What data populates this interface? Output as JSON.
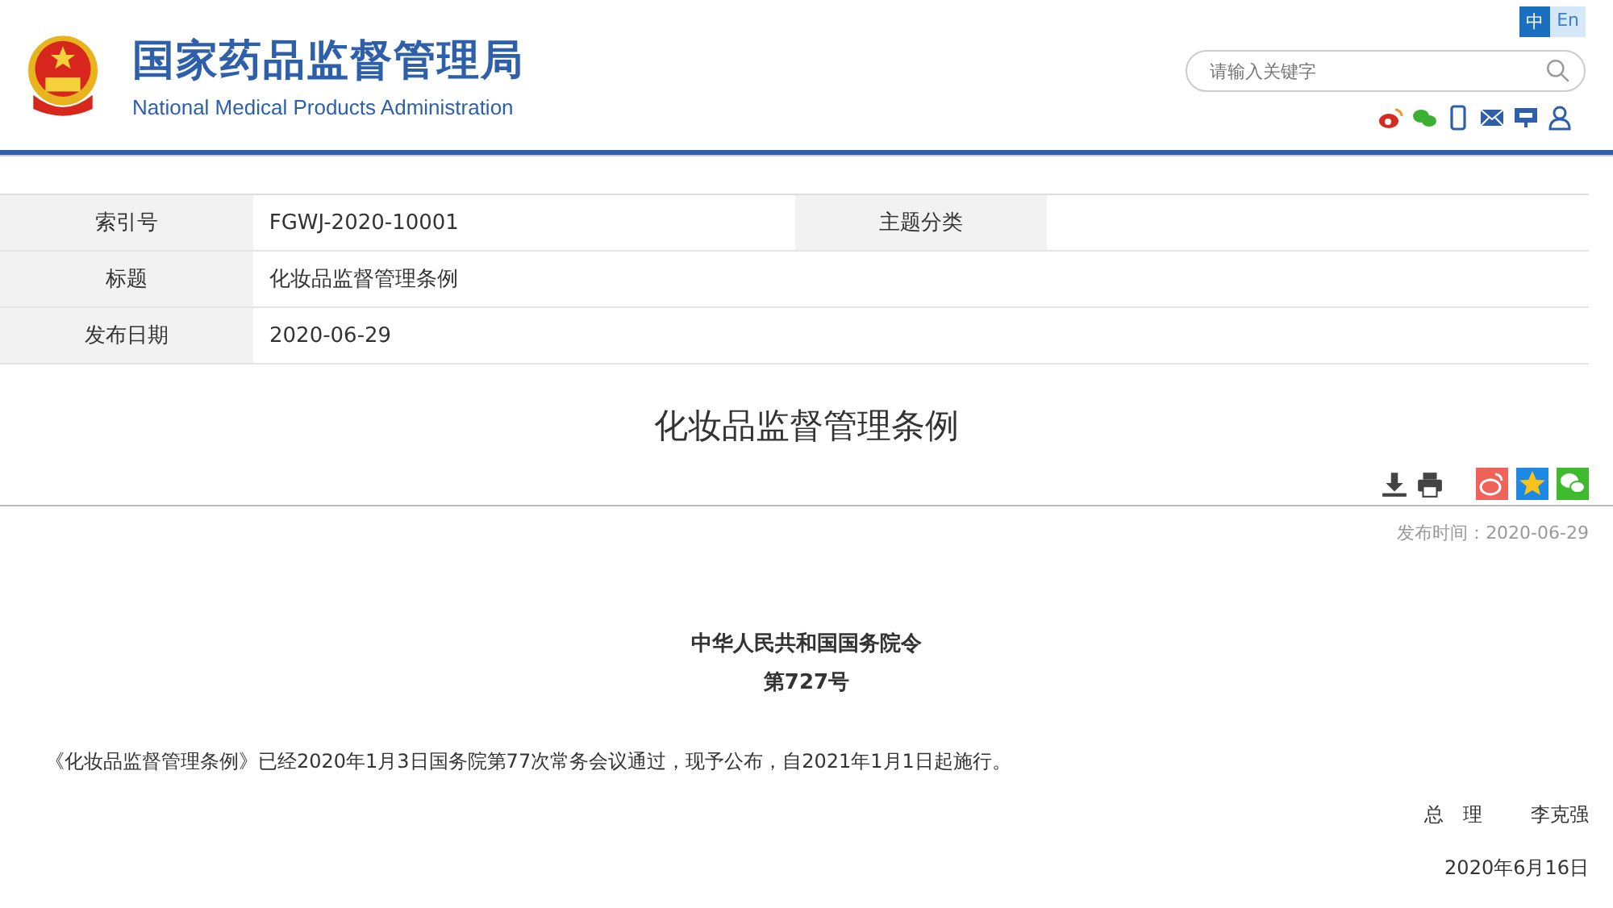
{
  "header": {
    "title": "国家药品监督管理局",
    "subtitle": "National Medical Products Administration",
    "languages": [
      {
        "label": "中",
        "selected": true
      },
      {
        "label": "En",
        "selected": false
      }
    ],
    "search": {
      "placeholder": "请输入关键字"
    }
  },
  "info_table": {
    "rows": [
      [
        {
          "label": "索引号",
          "value": "FGWJ-2020-10001"
        },
        {
          "label": "主题分类"
        }
      ],
      [
        {
          "label": "标题",
          "value": "化妆品监督管理条例"
        }
      ],
      [
        {
          "label": "发布日期",
          "value": "2020-06-29"
        }
      ]
    ]
  },
  "article": {
    "title": "化妆品监督管理条例",
    "publish_time": "发布时间：2020-06-29",
    "decree_issuer": "中华人民共和国国务院令",
    "decree_number": "第727号",
    "body": "《化妆品监督管理条例》已经2020年1月3日国务院第77次常务会议通过，现予公布，自2021年1月1日起施行。",
    "signer_title": "总　理",
    "signer_name": "李克强",
    "sign_date": "2020年6月16日"
  }
}
